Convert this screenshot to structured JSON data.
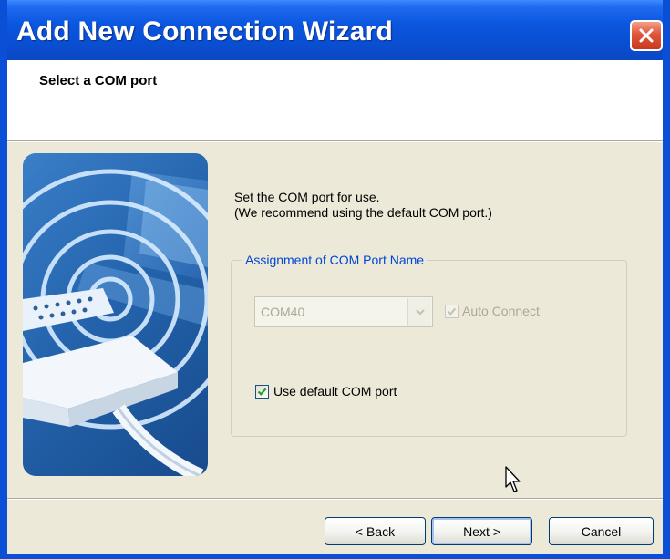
{
  "window": {
    "title": "Add New Connection Wizard"
  },
  "header": {
    "title": "Select a COM port"
  },
  "content": {
    "instruction_line1": "Set the COM port for use.",
    "instruction_line2": "(We recommend using the default COM port.)"
  },
  "group": {
    "legend": "Assignment of COM Port Name",
    "com_port": {
      "value": "COM40",
      "enabled": false
    },
    "auto_connect": {
      "label": "Auto Connect",
      "checked": true,
      "enabled": false
    },
    "use_default": {
      "label": "Use default COM port",
      "checked": true
    }
  },
  "buttons": {
    "back": "< Back",
    "next": "Next >",
    "cancel": "Cancel"
  },
  "colors": {
    "titlebar": "#0a4fd6",
    "dialog_bg": "#ece9d8",
    "group_legend": "#0046d5",
    "disabled_text": "#aca899",
    "check_green": "#21a121"
  },
  "icons": {
    "close": "close-icon",
    "dropdown": "chevron-down-icon",
    "check": "checkmark-icon",
    "cursor": "mouse-pointer-icon",
    "hero": "serial-cable-illustration"
  }
}
